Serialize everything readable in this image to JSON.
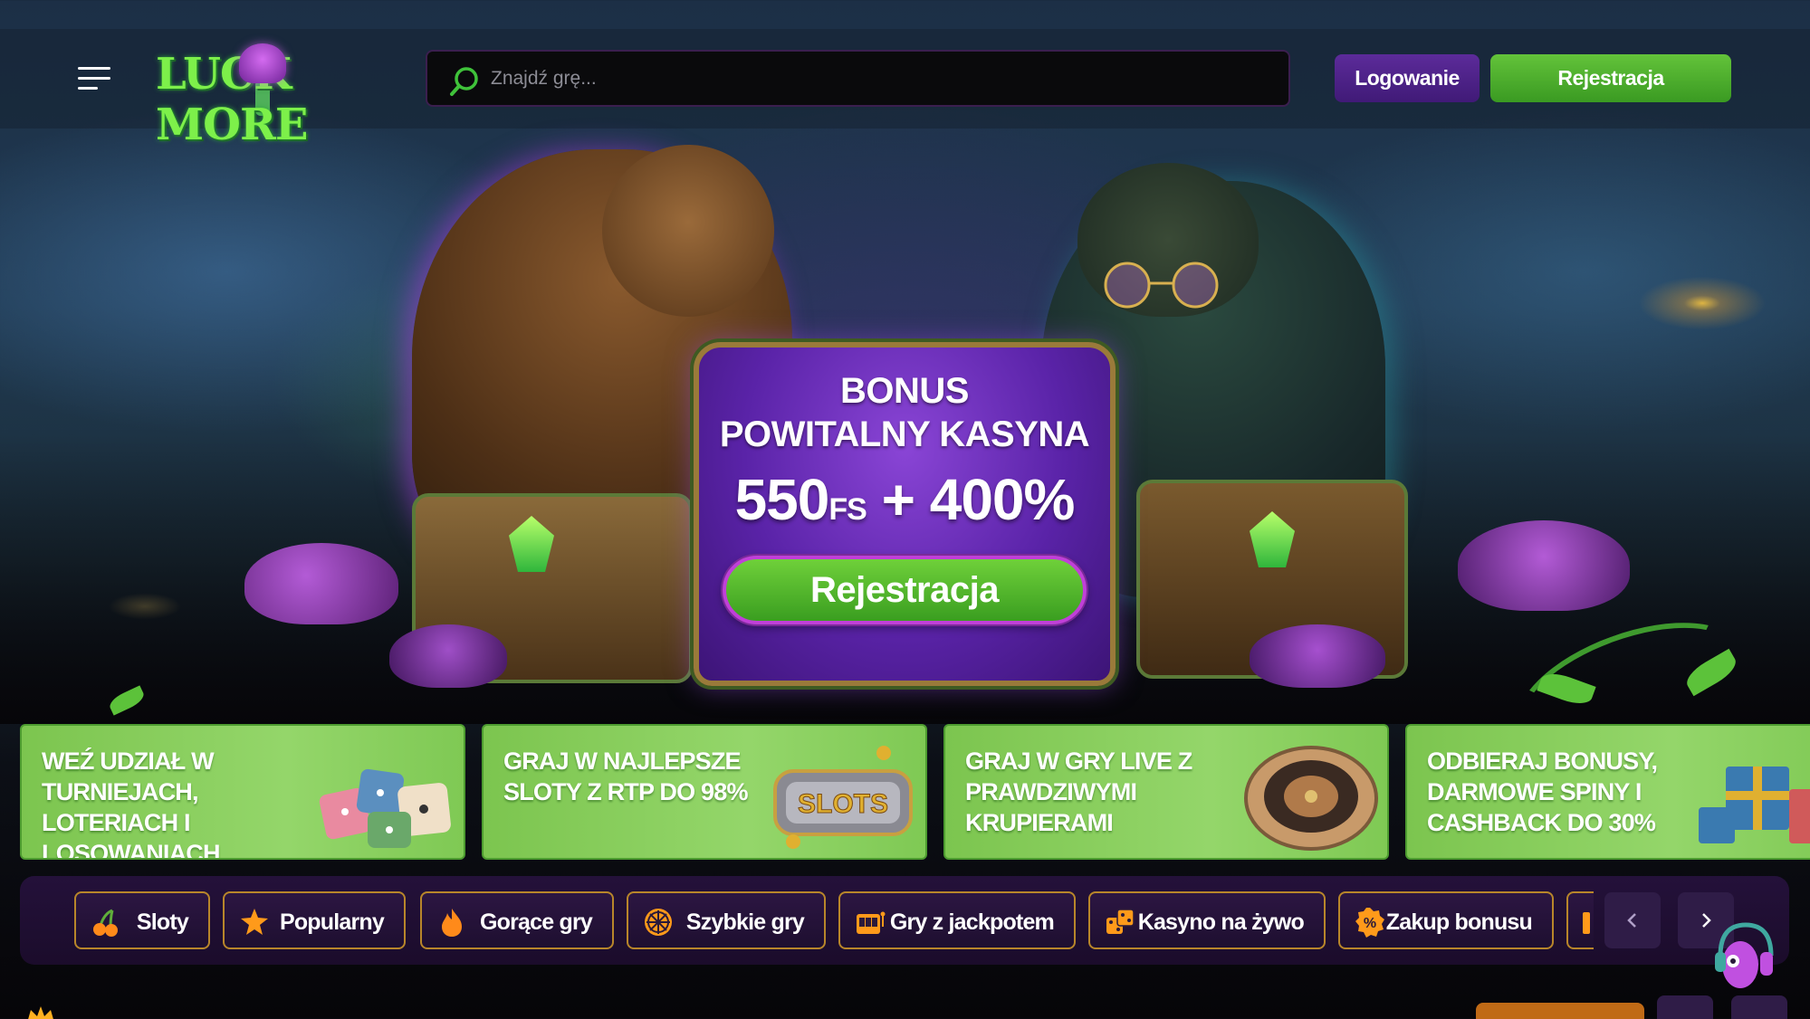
{
  "header": {
    "logo_text": "LUCK MORE",
    "search": {
      "placeholder": "Znajdź grę..."
    },
    "login_label": "Logowanie",
    "register_label": "Rejestracja"
  },
  "hero": {
    "title_line1": "BONUS",
    "title_line2": "POWITALNY KASYNA",
    "amount_main": "550",
    "amount_fs": "FS",
    "amount_rest": " + 400%",
    "cta_label": "Rejestracja"
  },
  "promos": [
    {
      "text": "WEŹ UDZIAŁ W TURNIEJACH, LOTERIACH I LOSOWANIACH",
      "icon": "dice-icon"
    },
    {
      "text": "GRAJ W NAJLEPSZE SLOTY Z RTP DO 98%",
      "icon": "slots-icon"
    },
    {
      "text": "GRAJ W GRY LIVE Z PRAWDZIWYMI KRUPIERAMI",
      "icon": "roulette-icon"
    },
    {
      "text": "ODBIERAJ BONUSY, DARMOWE SPINY I CASHBACK DO 30%",
      "icon": "gift-icon"
    }
  ],
  "categories": [
    {
      "label": "Sloty",
      "icon": "cherry-icon"
    },
    {
      "label": "Popularny",
      "icon": "star-icon"
    },
    {
      "label": "Gorące gry",
      "icon": "fire-icon"
    },
    {
      "label": "Szybkie gry",
      "icon": "wheel-icon"
    },
    {
      "label": "Gry z jackpotem",
      "icon": "slot-machine-icon"
    },
    {
      "label": "Kasyno na żywo",
      "icon": "dice-icon"
    },
    {
      "label": "Zakup bonusu",
      "icon": "percent-icon"
    }
  ],
  "colors": {
    "accent_green": "#4fb02c",
    "accent_purple": "#4a1f85",
    "chip_border": "#b8862a",
    "catbar_bg": "#1f0f31"
  }
}
